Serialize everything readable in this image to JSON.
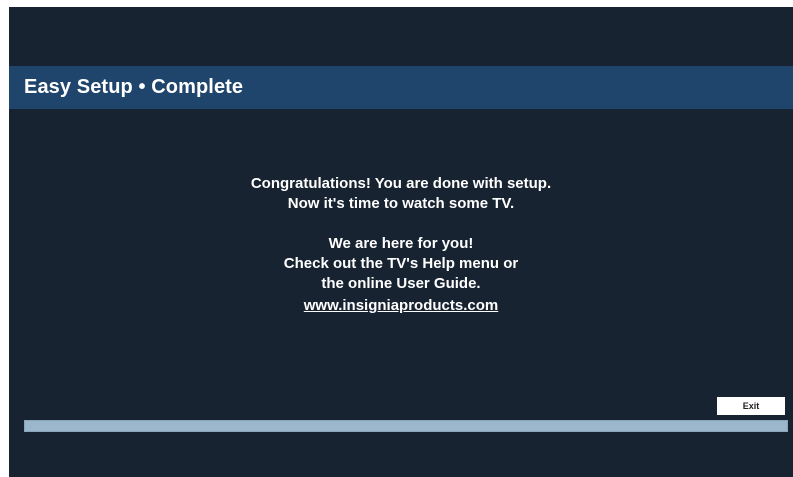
{
  "header": {
    "title": "Easy Setup • Complete"
  },
  "message": {
    "line1": "Congratulations! You are done with setup.",
    "line2": "Now it's time to watch some TV.",
    "line3": "We are here for you!",
    "line4": "Check out the TV's Help menu or",
    "line5": "the online User Guide.",
    "link": "www.insigniaproducts.com"
  },
  "controls": {
    "exit_label": "Exit"
  },
  "progress": {
    "value_percent": 100
  },
  "colors": {
    "background": "#172331",
    "title_bar": "#1f456d",
    "progress_fill": "#9cb7cc",
    "text": "#ffffff"
  }
}
